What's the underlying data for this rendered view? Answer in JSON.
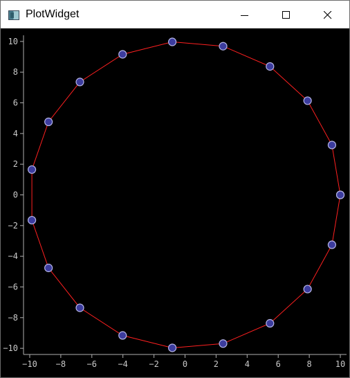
{
  "window": {
    "title": "PlotWidget",
    "icons": {
      "app": "app-window-icon",
      "minimize": "minimize-icon",
      "maximize": "maximize-icon",
      "close": "close-icon"
    }
  },
  "colors": {
    "background": "#000000",
    "line": "#ff2020",
    "marker_fill": "#3c3c9e",
    "marker_edge": "#b4b4e6",
    "axis": "#b0b0b0",
    "tick_text": "#c8c8c8"
  },
  "chart_data": {
    "type": "line",
    "title": "",
    "xlabel": "",
    "ylabel": "",
    "xlim": [
      -10.4,
      10.4
    ],
    "ylim": [
      -10.4,
      10.4
    ],
    "xticks": [
      "−10",
      "−8",
      "−6",
      "−4",
      "−2",
      "0",
      "2",
      "4",
      "6",
      "8",
      "10"
    ],
    "yticks": [
      "10",
      "8",
      "6",
      "4",
      "2",
      "0",
      "−2",
      "−4",
      "−6",
      "−8",
      "−10"
    ],
    "xtick_values": [
      -10,
      -8,
      -6,
      -4,
      -2,
      0,
      2,
      4,
      6,
      8,
      10
    ],
    "ytick_values": [
      10,
      8,
      6,
      4,
      2,
      0,
      -2,
      -4,
      -6,
      -8,
      -10
    ],
    "grid": false,
    "series": [
      {
        "x": [
          10.0,
          9.46,
          7.89,
          5.47,
          2.45,
          -0.82,
          -4.02,
          -6.77,
          -8.79,
          -9.86,
          -9.86,
          -8.79,
          -6.77,
          -4.02,
          -0.82,
          2.45,
          5.47,
          7.89,
          9.46,
          10.0
        ],
        "y": [
          0.0,
          3.25,
          6.14,
          8.37,
          9.69,
          9.97,
          9.16,
          7.36,
          4.76,
          1.65,
          -1.65,
          -4.76,
          -7.36,
          -9.16,
          -9.97,
          -9.69,
          -8.37,
          -6.14,
          -3.25,
          0.0
        ]
      }
    ]
  }
}
